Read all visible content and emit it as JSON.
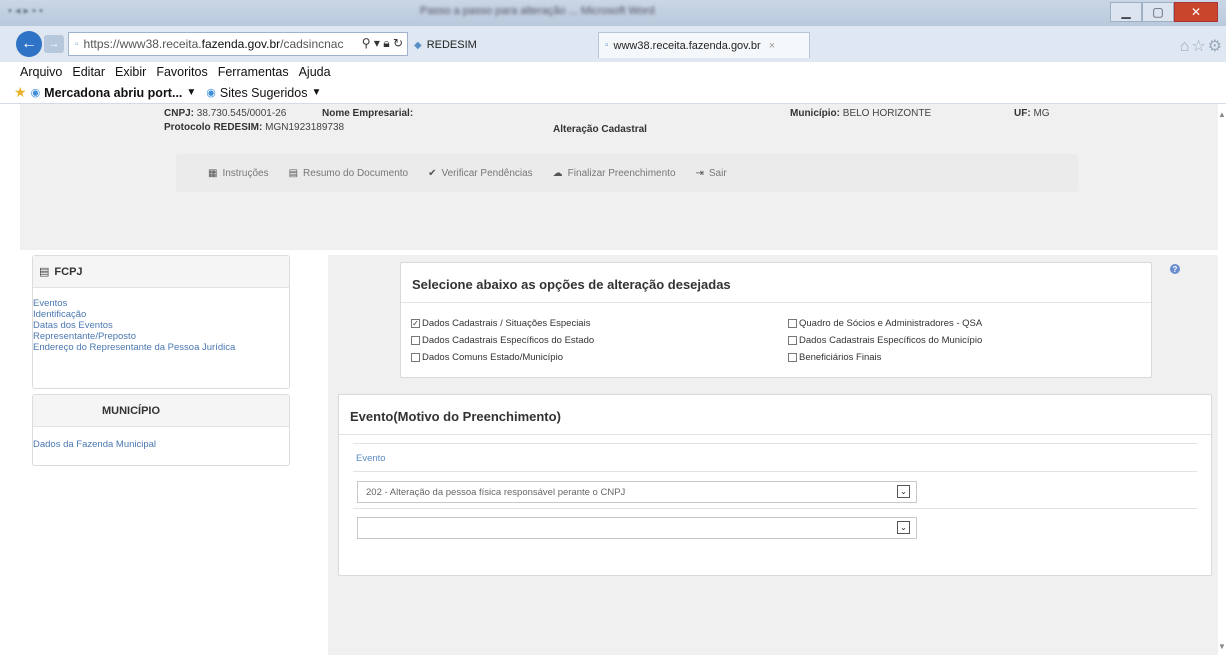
{
  "browser": {
    "window_title": "Passo a passo para alteração ... Microsoft Word",
    "url_prefix": "https://www38.receita.",
    "url_domain": "fazenda.gov.br",
    "url_suffix": "/cadsincnac",
    "tabs": [
      {
        "label": "REDESIM"
      },
      {
        "label": "www38.receita.fazenda.gov.br",
        "close": "×"
      }
    ],
    "menu": [
      "Arquivo",
      "Editar",
      "Exibir",
      "Favoritos",
      "Ferramentas",
      "Ajuda"
    ],
    "favorites": [
      {
        "label": "Mercadona abriu port...",
        "caret": "▼"
      },
      {
        "label": "Sites Sugeridos",
        "caret": "▼"
      }
    ]
  },
  "header": {
    "cnpj_label": "CNPJ:",
    "cnpj_value": "38.730.545/0001-26",
    "protocolo_label": "Protocolo REDESIM:",
    "protocolo_value": "MGN1923189738",
    "nome_label": "Nome Empresarial:",
    "alteracao": "Alteração Cadastral",
    "municipio_label": "Município:",
    "municipio_value": "BELO HORIZONTE",
    "uf_label": "UF:",
    "uf_value": "MG"
  },
  "toolbar": {
    "instrucoes": "Instruções",
    "resumo": "Resumo do Documento",
    "verificar": "Verificar Pendências",
    "finalizar": "Finalizar Preenchimento",
    "sair": "Sair"
  },
  "sidebar": {
    "fcpj_title": "FCPJ",
    "fcpj_links": [
      "Eventos",
      "Identificação",
      "Datas dos Eventos",
      "Representante/Preposto",
      "Endereço do Representante da Pessoa Jurídica"
    ],
    "municipio_title": "MUNICÍPIO",
    "municipio_links": [
      "Dados da Fazenda Municipal"
    ]
  },
  "options_panel": {
    "title": "Selecione abaixo as opções de alteração desejadas",
    "options": [
      {
        "label": "Dados Cadastrais / Situações Especiais",
        "checked": true
      },
      {
        "label": "Dados Cadastrais Específicos do Estado",
        "checked": false
      },
      {
        "label": "Dados Comuns Estado/Município",
        "checked": false
      },
      {
        "label": "Quadro de Sócios e Administradores - QSA",
        "checked": false
      },
      {
        "label": "Dados Cadastrais Específicos do Município",
        "checked": false
      },
      {
        "label": "Beneficiários Finais",
        "checked": false
      }
    ],
    "check_mark": "✓"
  },
  "evento_panel": {
    "title": "Evento(Motivo do Preenchimento)",
    "field_label": "Evento",
    "select1_value": "202 - Alteração da pessoa física responsável perante o CNPJ",
    "select2_value": ""
  }
}
